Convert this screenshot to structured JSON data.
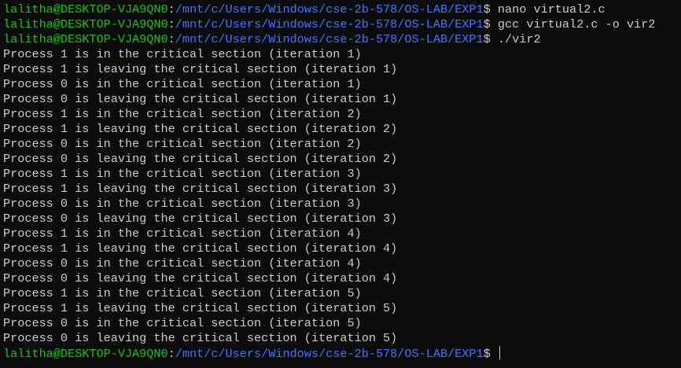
{
  "colors": {
    "background": "#0c0c0c",
    "text": "#cccccc",
    "user": "#16c60c",
    "path": "#3b78ff"
  },
  "prompt": {
    "user": "lalitha@DESKTOP-VJA9QN0",
    "path": "/mnt/c/Users/Windows/cse-2b-578/OS-LAB/EXP1"
  },
  "commands": [
    "nano virtual2.c",
    "gcc virtual2.c -o vir2",
    "./vir2"
  ],
  "output": [
    "Process 1 is in the critical section (iteration 1)",
    "Process 1 is leaving the critical section (iteration 1)",
    "Process 0 is in the critical section (iteration 1)",
    "Process 0 is leaving the critical section (iteration 1)",
    "Process 1 is in the critical section (iteration 2)",
    "Process 1 is leaving the critical section (iteration 2)",
    "Process 0 is in the critical section (iteration 2)",
    "Process 0 is leaving the critical section (iteration 2)",
    "Process 1 is in the critical section (iteration 3)",
    "Process 1 is leaving the critical section (iteration 3)",
    "Process 0 is in the critical section (iteration 3)",
    "Process 0 is leaving the critical section (iteration 3)",
    "Process 1 is in the critical section (iteration 4)",
    "Process 1 is leaving the critical section (iteration 4)",
    "Process 0 is in the critical section (iteration 4)",
    "Process 0 is leaving the critical section (iteration 4)",
    "Process 1 is in the critical section (iteration 5)",
    "Process 1 is leaving the critical section (iteration 5)",
    "Process 0 is in the critical section (iteration 5)",
    "Process 0 is leaving the critical section (iteration 5)"
  ],
  "final_command": ""
}
